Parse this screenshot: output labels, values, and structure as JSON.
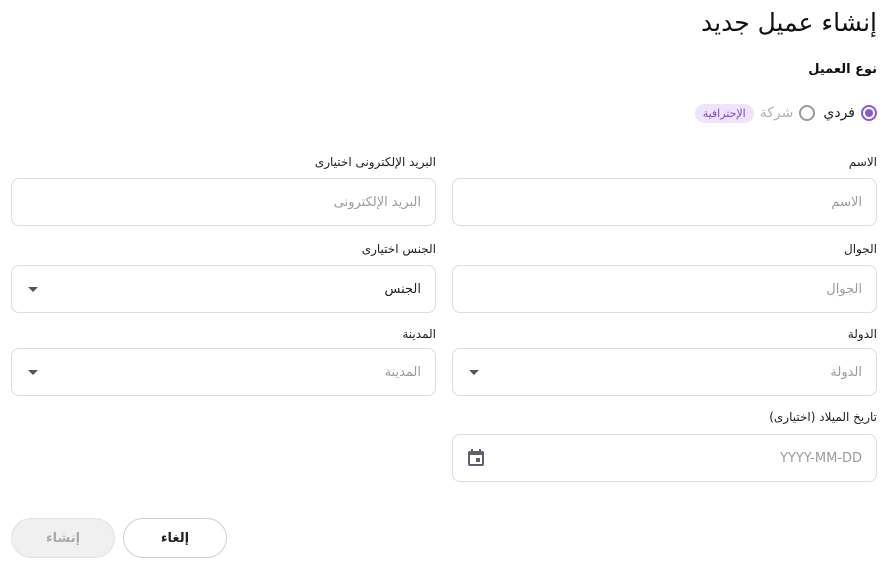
{
  "page": {
    "title": "إنشاء عميل جديد"
  },
  "client_type": {
    "label": "نوع العميل",
    "options": [
      {
        "label": "فردي",
        "selected": true
      },
      {
        "label": "شركة",
        "selected": false,
        "badge": "الإحترافية"
      }
    ]
  },
  "form": {
    "name": {
      "label": "الاسم",
      "placeholder": "الاسم"
    },
    "email": {
      "label": "البريد الإلكترونى اختيارى",
      "placeholder": "البريد الإلكترونى"
    },
    "mobile": {
      "label": "الجوال",
      "placeholder": "الجوال"
    },
    "gender": {
      "label": "الجنس اختيارى",
      "value": "الجنس"
    },
    "country": {
      "label": "الدولة",
      "placeholder": "الدولة"
    },
    "city": {
      "label": "المدينة",
      "placeholder": "المدينة"
    },
    "birth_date": {
      "label": "تاريخ الميلاد (اختيارى)",
      "placeholder": "YYYY-MM-DD"
    }
  },
  "actions": {
    "cancel": "إلغاء",
    "create": "إنشاء"
  },
  "colors": {
    "accent": "#8c57d6",
    "badge_bg": "#efe4fb",
    "border": "#dcdcdc"
  },
  "icons": {
    "dropdown": "caret-down-icon",
    "date": "calendar-icon"
  }
}
